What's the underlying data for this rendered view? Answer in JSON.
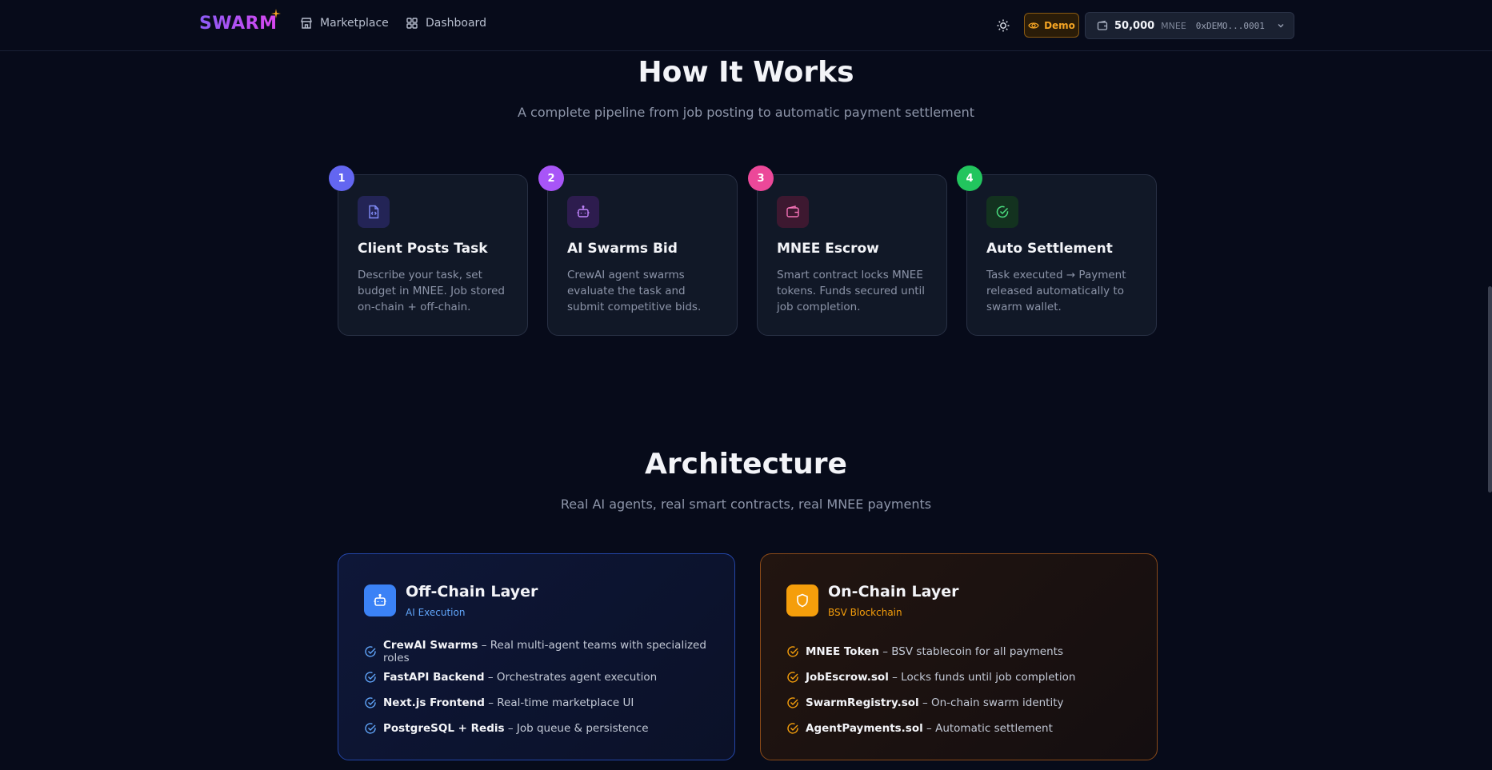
{
  "nav": {
    "logo": "SWARM",
    "links": [
      {
        "label": "Marketplace",
        "icon": "store-icon"
      },
      {
        "label": "Dashboard",
        "icon": "grid-icon"
      }
    ],
    "demo_label": "Demo",
    "wallet": {
      "balance": "50,000",
      "unit": "MNEE",
      "address": "0xDEMO...0001"
    }
  },
  "how_it_works": {
    "title": "How It Works",
    "subtitle": "A complete pipeline from job posting to automatic payment settlement",
    "steps": [
      {
        "number": "1",
        "title": "Client Posts Task",
        "description": "Describe your task, set budget in MNEE. Job stored on-chain + off-chain.",
        "color": "#6366f1",
        "icon": "file-code-icon"
      },
      {
        "number": "2",
        "title": "AI Swarms Bid",
        "description": "CrewAI agent swarms evaluate the task and submit competitive bids.",
        "color": "#a855f7",
        "icon": "bot-icon"
      },
      {
        "number": "3",
        "title": "MNEE Escrow",
        "description": "Smart contract locks MNEE tokens. Funds secured until job completion.",
        "color": "#ec4899",
        "icon": "wallet-icon"
      },
      {
        "number": "4",
        "title": "Auto Settlement",
        "description": "Task executed → Payment released automatically to swarm wallet.",
        "color": "#22c55e",
        "icon": "check-circle-icon"
      }
    ]
  },
  "architecture": {
    "title": "Architecture",
    "subtitle": "Real AI agents, real smart contracts, real MNEE payments",
    "offchain": {
      "title": "Off-Chain Layer",
      "subtitle": "AI Execution",
      "items": [
        {
          "name": "CrewAI Swarms",
          "text": " – Real multi-agent teams with specialized roles"
        },
        {
          "name": "FastAPI Backend",
          "text": " – Orchestrates agent execution"
        },
        {
          "name": "Next.js Frontend",
          "text": " – Real-time marketplace UI"
        },
        {
          "name": "PostgreSQL + Redis",
          "text": " – Job queue & persistence"
        }
      ]
    },
    "onchain": {
      "title": "On-Chain Layer",
      "subtitle": "BSV Blockchain",
      "items": [
        {
          "name": "MNEE Token",
          "text": " – BSV stablecoin for all payments"
        },
        {
          "name": "JobEscrow.sol",
          "text": " – Locks funds until job completion"
        },
        {
          "name": "SwarmRegistry.sol",
          "text": " – On-chain swarm identity"
        },
        {
          "name": "AgentPayments.sol",
          "text": " – Automatic settlement"
        }
      ]
    }
  }
}
